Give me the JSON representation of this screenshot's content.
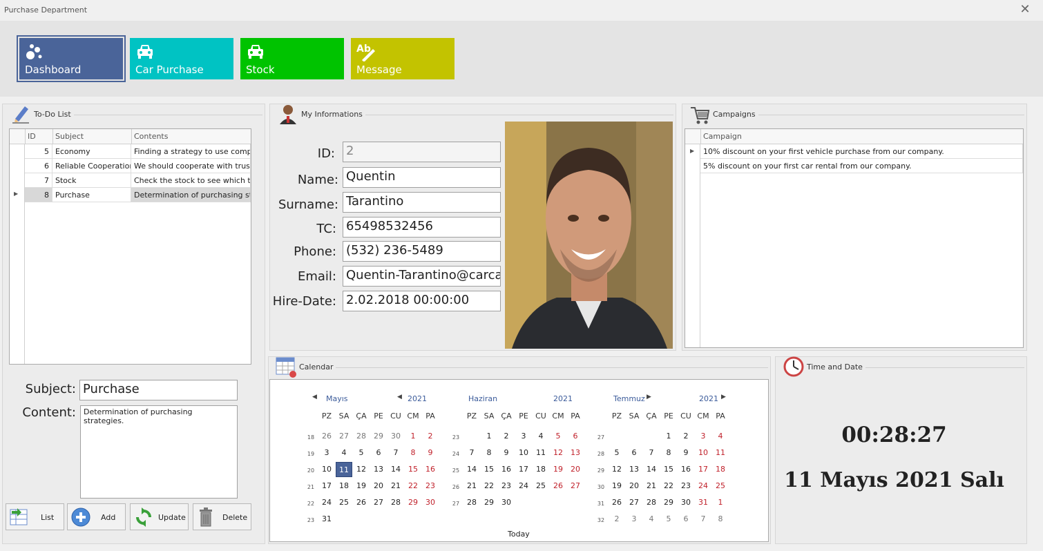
{
  "window": {
    "title": "Purchase Department",
    "close": "✕"
  },
  "tiles": [
    {
      "label": "Dashboard",
      "color": "#4a6499",
      "icon": "bubbles-icon"
    },
    {
      "label": "Car Purchase",
      "color": "#00c3c3",
      "icon": "car-icon"
    },
    {
      "label": "Stock",
      "color": "#00c300",
      "icon": "car-icon"
    },
    {
      "label": "Message",
      "color": "#c3c300",
      "icon": "text-edit-icon"
    }
  ],
  "todo": {
    "title": "To-Do List",
    "headers": {
      "id": "ID",
      "subject": "Subject",
      "contents": "Contents"
    },
    "rows": [
      {
        "id": "5",
        "subject": "Economy",
        "contents": "Finding a strategy to use compa..."
      },
      {
        "id": "6",
        "subject": "Reliable Cooperation",
        "contents": "We should cooperate with trust..."
      },
      {
        "id": "7",
        "subject": "Stock",
        "contents": "Check the stock to see which ty..."
      },
      {
        "id": "8",
        "subject": "Purchase",
        "contents": "Determination of purchasing str..."
      }
    ],
    "subject_label": "Subject:",
    "subject_value": "Purchase",
    "content_label": "Content:",
    "content_value": "Determination of purchasing strategies.",
    "buttons": {
      "list": "List",
      "add": "Add",
      "update": "Update",
      "delete": "Delete"
    }
  },
  "info": {
    "title": "My Informations",
    "fields": [
      {
        "label": "ID:",
        "value": "2"
      },
      {
        "label": "Name:",
        "value": "Quentin"
      },
      {
        "label": "Surname:",
        "value": "Tarantino"
      },
      {
        "label": "TC:",
        "value": "65498532456"
      },
      {
        "label": "Phone:",
        "value": "(532) 236-5489"
      },
      {
        "label": "Email:",
        "value": "Quentin-Tarantino@carcar"
      },
      {
        "label": "Hire-Date:",
        "value": "2.02.2018 00:00:00"
      }
    ]
  },
  "campaigns": {
    "title": "Campaigns",
    "header": "Campaign",
    "rows": [
      "10% discount on your first vehicle purchase from our company.",
      "5% discount on your first car rental from our company."
    ]
  },
  "calendar": {
    "title": "Calendar",
    "today": "Today",
    "weekdays": [
      "PZ",
      "SA",
      "ÇA",
      "PE",
      "CU",
      "CM",
      "PA"
    ],
    "months": [
      {
        "name": "Mayıs",
        "year": "2021",
        "weeks": [
          "18",
          "19",
          "20",
          "21",
          "22",
          "23"
        ],
        "days": [
          [
            "26",
            "27",
            "28",
            "29",
            "30",
            "1",
            "2"
          ],
          [
            "3",
            "4",
            "5",
            "6",
            "7",
            "8",
            "9"
          ],
          [
            "10",
            "11",
            "12",
            "13",
            "14",
            "15",
            "16"
          ],
          [
            "17",
            "18",
            "19",
            "20",
            "21",
            "22",
            "23"
          ],
          [
            "24",
            "25",
            "26",
            "27",
            "28",
            "29",
            "30"
          ],
          [
            "31",
            "",
            "",
            "",
            "",
            "",
            ""
          ]
        ]
      },
      {
        "name": "Haziran",
        "year": "2021",
        "weeks": [
          "23",
          "24",
          "25",
          "26",
          "27",
          ""
        ],
        "days": [
          [
            "",
            "1",
            "2",
            "3",
            "4",
            "5",
            "6"
          ],
          [
            "7",
            "8",
            "9",
            "10",
            "11",
            "12",
            "13"
          ],
          [
            "14",
            "15",
            "16",
            "17",
            "18",
            "19",
            "20"
          ],
          [
            "21",
            "22",
            "23",
            "24",
            "25",
            "26",
            "27"
          ],
          [
            "28",
            "29",
            "30",
            "",
            "",
            "",
            ""
          ],
          [
            "",
            "",
            "",
            "",
            "",
            "",
            ""
          ]
        ]
      },
      {
        "name": "Temmuz",
        "year": "2021",
        "weeks": [
          "27",
          "28",
          "29",
          "30",
          "31",
          "32"
        ],
        "days": [
          [
            "",
            "",
            "",
            "1",
            "2",
            "3",
            "4"
          ],
          [
            "5",
            "6",
            "7",
            "8",
            "9",
            "10",
            "11"
          ],
          [
            "12",
            "13",
            "14",
            "15",
            "16",
            "17",
            "18"
          ],
          [
            "19",
            "20",
            "21",
            "22",
            "23",
            "24",
            "25"
          ],
          [
            "26",
            "27",
            "28",
            "29",
            "30",
            "31",
            "1"
          ],
          [
            "2",
            "3",
            "4",
            "5",
            "6",
            "7",
            "8"
          ]
        ]
      }
    ]
  },
  "time": {
    "title": "Time and Date",
    "clock": "00:28:27",
    "date": "11 Mayıs 2021 Salı"
  }
}
